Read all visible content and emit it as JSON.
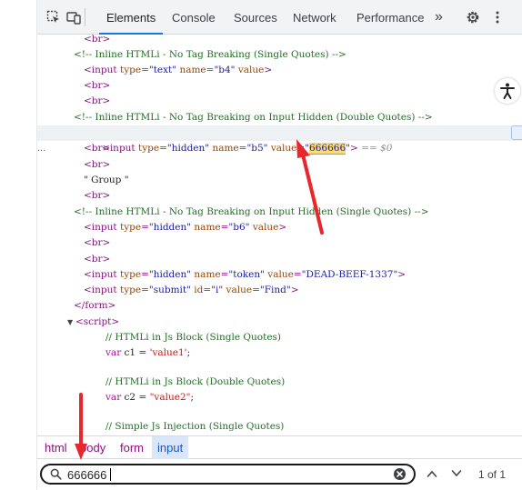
{
  "toolbar": {
    "tabs": [
      {
        "label": "Elements",
        "active": true
      },
      {
        "label": "Console"
      },
      {
        "label": "Sources"
      },
      {
        "label": "Network"
      },
      {
        "label": "Performance"
      }
    ],
    "more_label": "»"
  },
  "code": {
    "lines": [
      {
        "text": "<br>"
      },
      {
        "text": "<!-- Inline HTMLi - No Tag Breaking (Single Quotes) -->"
      },
      {
        "text": "<input type=\"text\" name=\"b4\" value>"
      },
      {
        "text": "<br>"
      },
      {
        "text": "<br>"
      },
      {
        "text": "<!-- Inline HTMLi - No Tag Breaking on Input Hidden (Double Quotes) -->"
      },
      {
        "text": "<input type=\"hidden\" name=\"b5\" value=\"666666\"> == $0"
      },
      {
        "text": "<br>"
      },
      {
        "text": "<br>"
      },
      {
        "text": "\" Group \""
      },
      {
        "text": "<br>"
      },
      {
        "text": "<!-- Inline HTMLi - No Tag Breaking on Input Hidden (Single Quotes) -->"
      },
      {
        "text": "<input type=\"hidden\" name=\"b6\" value>"
      },
      {
        "text": "<br>"
      },
      {
        "text": "<br>"
      },
      {
        "text": "<input type=\"hidden\" name=\"token\" value=\"DEAD-BEEF-1337\">"
      },
      {
        "text": "<input type=\"submit\" id=\"i\" value=\"Find\">"
      },
      {
        "text": "</form>"
      },
      {
        "text": "<script>"
      },
      {
        "text": "// HTMLi in Js Block (Single Quotes)"
      },
      {
        "text": "var c1 = 'value1';"
      },
      {
        "text": ""
      },
      {
        "text": "// HTMLi in Js Block (Double Quotes)"
      },
      {
        "text": "var c2 = \"value2\";"
      },
      {
        "text": ""
      },
      {
        "text": "// Simple Js Injection (Single Quotes)"
      }
    ],
    "match_value": "666666",
    "selected_marker": "== $0",
    "row_dots": "..."
  },
  "breadcrumb": [
    "html",
    "body",
    "form",
    "input"
  ],
  "search": {
    "value": "666666",
    "count": "1 of 1"
  },
  "colors": {
    "annotation_arrow": "#e8262b",
    "accent": "#1a73e8",
    "match_highlight": "#f9d97a"
  }
}
